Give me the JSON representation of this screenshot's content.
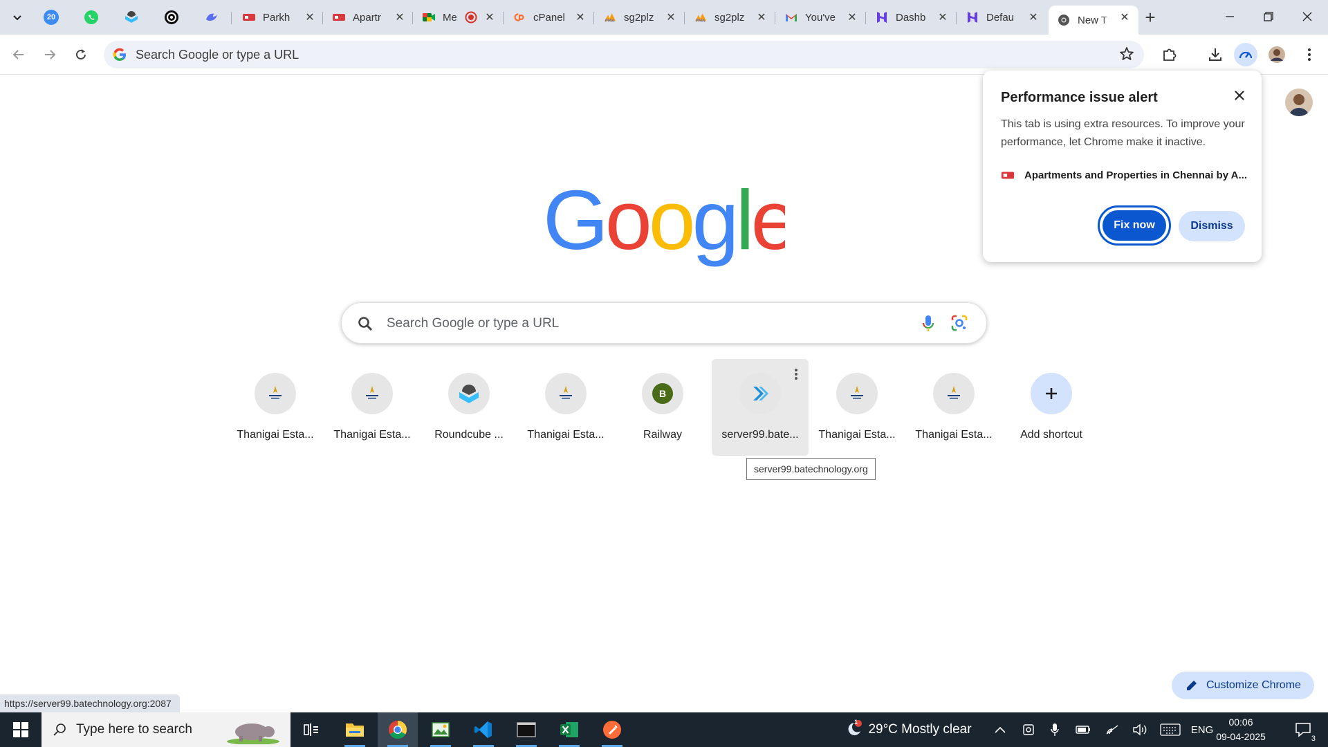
{
  "browser": {
    "tabs": [
      {
        "label": "Parkh",
        "favicon": "parkhome-red-icon"
      },
      {
        "label": "Apartr",
        "favicon": "parkhome-red-icon"
      },
      {
        "label": "Me",
        "favicon": "google-meet-icon"
      },
      {
        "label": "cPanel",
        "favicon": "cpanel-icon"
      },
      {
        "label": "sg2plz",
        "favicon": "phpmyadmin-icon"
      },
      {
        "label": "sg2plz",
        "favicon": "phpmyadmin-icon"
      },
      {
        "label": "You've",
        "favicon": "gmail-icon"
      },
      {
        "label": "Dashb",
        "favicon": "h-logo-icon"
      },
      {
        "label": "Defau",
        "favicon": "h-logo-icon"
      },
      {
        "label": "New T",
        "favicon": "chrome-icon",
        "active": true
      }
    ],
    "pinned_badge": "20",
    "omnibox": {
      "placeholder": "Search Google or type a URL"
    }
  },
  "ntp": {
    "logo_text": "Google",
    "search_placeholder": "Search Google or type a URL",
    "shortcuts": [
      {
        "label": "Thanigai Esta...",
        "icon": "thanigai-logo-icon"
      },
      {
        "label": "Thanigai Esta...",
        "icon": "thanigai-logo-icon"
      },
      {
        "label": "Roundcube ...",
        "icon": "roundcube-icon"
      },
      {
        "label": "Thanigai Esta...",
        "icon": "thanigai-logo-icon"
      },
      {
        "label": "Railway",
        "icon": "letter-b-icon",
        "letter": "B"
      },
      {
        "label": "server99.bate...",
        "icon": "server-arrow-icon",
        "hover": true
      },
      {
        "label": "Thanigai Esta...",
        "icon": "thanigai-logo-icon"
      },
      {
        "label": "Thanigai Esta...",
        "icon": "thanigai-logo-icon"
      },
      {
        "label": "Add shortcut",
        "icon": "plus-icon"
      }
    ],
    "tooltip": "server99.batechnology.org",
    "customize_label": "Customize Chrome",
    "status_url": "https://server99.batechnology.org:2087"
  },
  "perf_alert": {
    "title": "Performance issue alert",
    "body": "This tab is using extra resources. To improve your performance, let Chrome make it inactive.",
    "tab_title": "Apartments and Properties in Chennai by A...",
    "fix_label": "Fix now",
    "dismiss_label": "Dismiss"
  },
  "taskbar": {
    "search_placeholder": "Type here to search",
    "weather": "29°C  Mostly clear",
    "weather_badge": "1",
    "language": "ENG",
    "time": "00:06",
    "date": "09-04-2025",
    "notification_count": "3"
  },
  "colors": {
    "accent_blue": "#0b57d0",
    "tonal_blue": "#d3e3fd",
    "tabstrip_bg": "#dfe3ec",
    "taskbar_bg": "#1b2530"
  }
}
